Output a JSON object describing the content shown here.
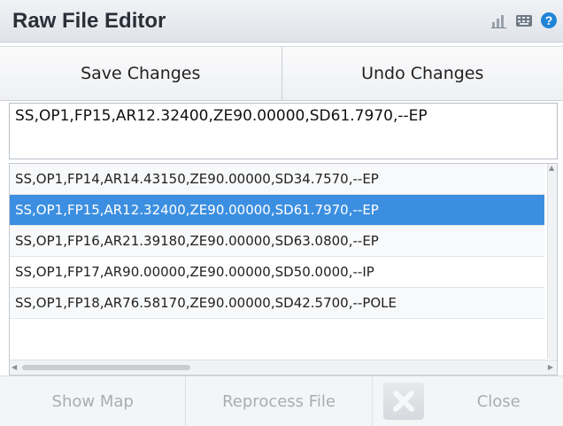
{
  "window": {
    "title": "Raw File Editor",
    "icons": [
      "chart-icon",
      "keyboard-icon",
      "help-icon"
    ]
  },
  "toolbar": {
    "save_label": "Save Changes",
    "undo_label": "Undo Changes"
  },
  "editor": {
    "value": "SS,OP1,FP15,AR12.32400,ZE90.00000,SD61.7970,--EP"
  },
  "list": {
    "rows": [
      "SS,OP1,FP14,AR14.43150,ZE90.00000,SD34.7570,--EP",
      "SS,OP1,FP15,AR12.32400,ZE90.00000,SD61.7970,--EP",
      "SS,OP1,FP16,AR21.39180,ZE90.00000,SD63.0800,--EP",
      "SS,OP1,FP17,AR90.00000,ZE90.00000,SD50.0000,--IP",
      "SS,OP1,FP18,AR76.58170,ZE90.00000,SD42.5700,--POLE"
    ],
    "selected_index": 1
  },
  "bottom": {
    "show_map": "Show Map",
    "reprocess": "Reprocess File",
    "close": "Close"
  },
  "colors": {
    "selection": "#3c8fe0",
    "help": "#1f84d6"
  }
}
